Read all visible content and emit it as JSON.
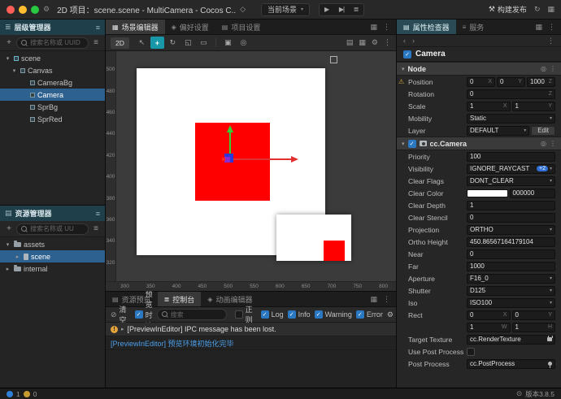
{
  "titlebar": {
    "title": "2D 项目：scene.scene - MultiCamera - Cocos C...",
    "scene_selector": "当前场景",
    "build_label": "构建发布"
  },
  "hierarchy": {
    "title": "层级管理器",
    "search_placeholder": "搜索名称或 UUID",
    "items": [
      {
        "label": "scene"
      },
      {
        "label": "Canvas"
      },
      {
        "label": "CameraBg"
      },
      {
        "label": "Camera"
      },
      {
        "label": "SprBg"
      },
      {
        "label": "SprRed"
      }
    ]
  },
  "assets": {
    "title": "资源管理器",
    "search_placeholder": "搜索名称或 UU",
    "items": [
      {
        "label": "assets"
      },
      {
        "label": "scene"
      },
      {
        "label": "internal"
      }
    ]
  },
  "scene_editor": {
    "tabs": [
      {
        "label": "场景编辑器"
      },
      {
        "label": "偏好设置"
      },
      {
        "label": "项目设置"
      }
    ],
    "mode_button": "2D",
    "ruler_h": [
      "300",
      "350",
      "400",
      "450",
      "500",
      "550",
      "600",
      "650",
      "700",
      "750",
      "800"
    ],
    "ruler_v": [
      "500",
      "480",
      "460",
      "440",
      "420",
      "400",
      "380",
      "360",
      "340",
      "320"
    ]
  },
  "console": {
    "tabs": [
      {
        "label": "资源预览"
      },
      {
        "label": "控制台"
      },
      {
        "label": "动画编辑器"
      }
    ],
    "clear_label": "清空",
    "clear_on_preview_label": "预览时清空",
    "search_placeholder": "搜索",
    "regex_label": "正则",
    "filters": [
      {
        "label": "Log"
      },
      {
        "label": "Info"
      },
      {
        "label": "Warning"
      },
      {
        "label": "Error"
      }
    ],
    "messages": [
      {
        "type": "warning",
        "text": "[PreviewInEditor] IPC message has been lost."
      },
      {
        "type": "info",
        "text": "[PreviewInEditor] 预览环境初始化完毕"
      }
    ]
  },
  "inspector": {
    "tabs": [
      {
        "label": "属性检查器"
      },
      {
        "label": "服务"
      }
    ],
    "node_name": "Camera",
    "axis": {
      "x": "X",
      "y": "Y",
      "z": "Z",
      "w": "W",
      "h": "H"
    },
    "node_section": {
      "title": "Node",
      "position": {
        "label": "Position",
        "x": "0",
        "y": "0",
        "z": "1000"
      },
      "rotation": {
        "label": "Rotation",
        "z": "0"
      },
      "scale": {
        "label": "Scale",
        "x": "1",
        "y": "1"
      },
      "mobility": {
        "label": "Mobility",
        "value": "Static"
      },
      "layer": {
        "label": "Layer",
        "value": "DEFAULT",
        "edit_label": "Edit"
      }
    },
    "camera_section": {
      "title": "cc.Camera",
      "priority": {
        "label": "Priority",
        "value": "100"
      },
      "visibility": {
        "label": "Visibility",
        "value": "IGNORE_RAYCAST",
        "badge": "+2"
      },
      "clear_flags": {
        "label": "Clear Flags",
        "value": "DONT_CLEAR"
      },
      "clear_color": {
        "label": "Clear Color",
        "value": "000000",
        "swatch": "#FFFFFF"
      },
      "clear_depth": {
        "label": "Clear Depth",
        "value": "1"
      },
      "clear_stencil": {
        "label": "Clear Stencil",
        "value": "0"
      },
      "projection": {
        "label": "Projection",
        "value": "ORTHO"
      },
      "ortho_height": {
        "label": "Ortho Height",
        "value": "450.86567164179104"
      },
      "near": {
        "label": "Near",
        "value": "0"
      },
      "far": {
        "label": "Far",
        "value": "1000"
      },
      "aperture": {
        "label": "Aperture",
        "value": "F16_0"
      },
      "shutter": {
        "label": "Shutter",
        "value": "D125"
      },
      "iso": {
        "label": "Iso",
        "value": "ISO100"
      },
      "rect": {
        "label": "Rect",
        "x": "0",
        "y": "0",
        "w": "1",
        "h": "1"
      },
      "target_texture": {
        "label": "Target Texture",
        "value": "cc.RenderTexture"
      },
      "use_post_process": {
        "label": "Use Post Process"
      },
      "post_process": {
        "label": "Post Process",
        "value": "cc.PostProcess"
      }
    }
  },
  "statusbar": {
    "info_count": "1",
    "warning_count": "0",
    "version": "版本3.8.5"
  }
}
